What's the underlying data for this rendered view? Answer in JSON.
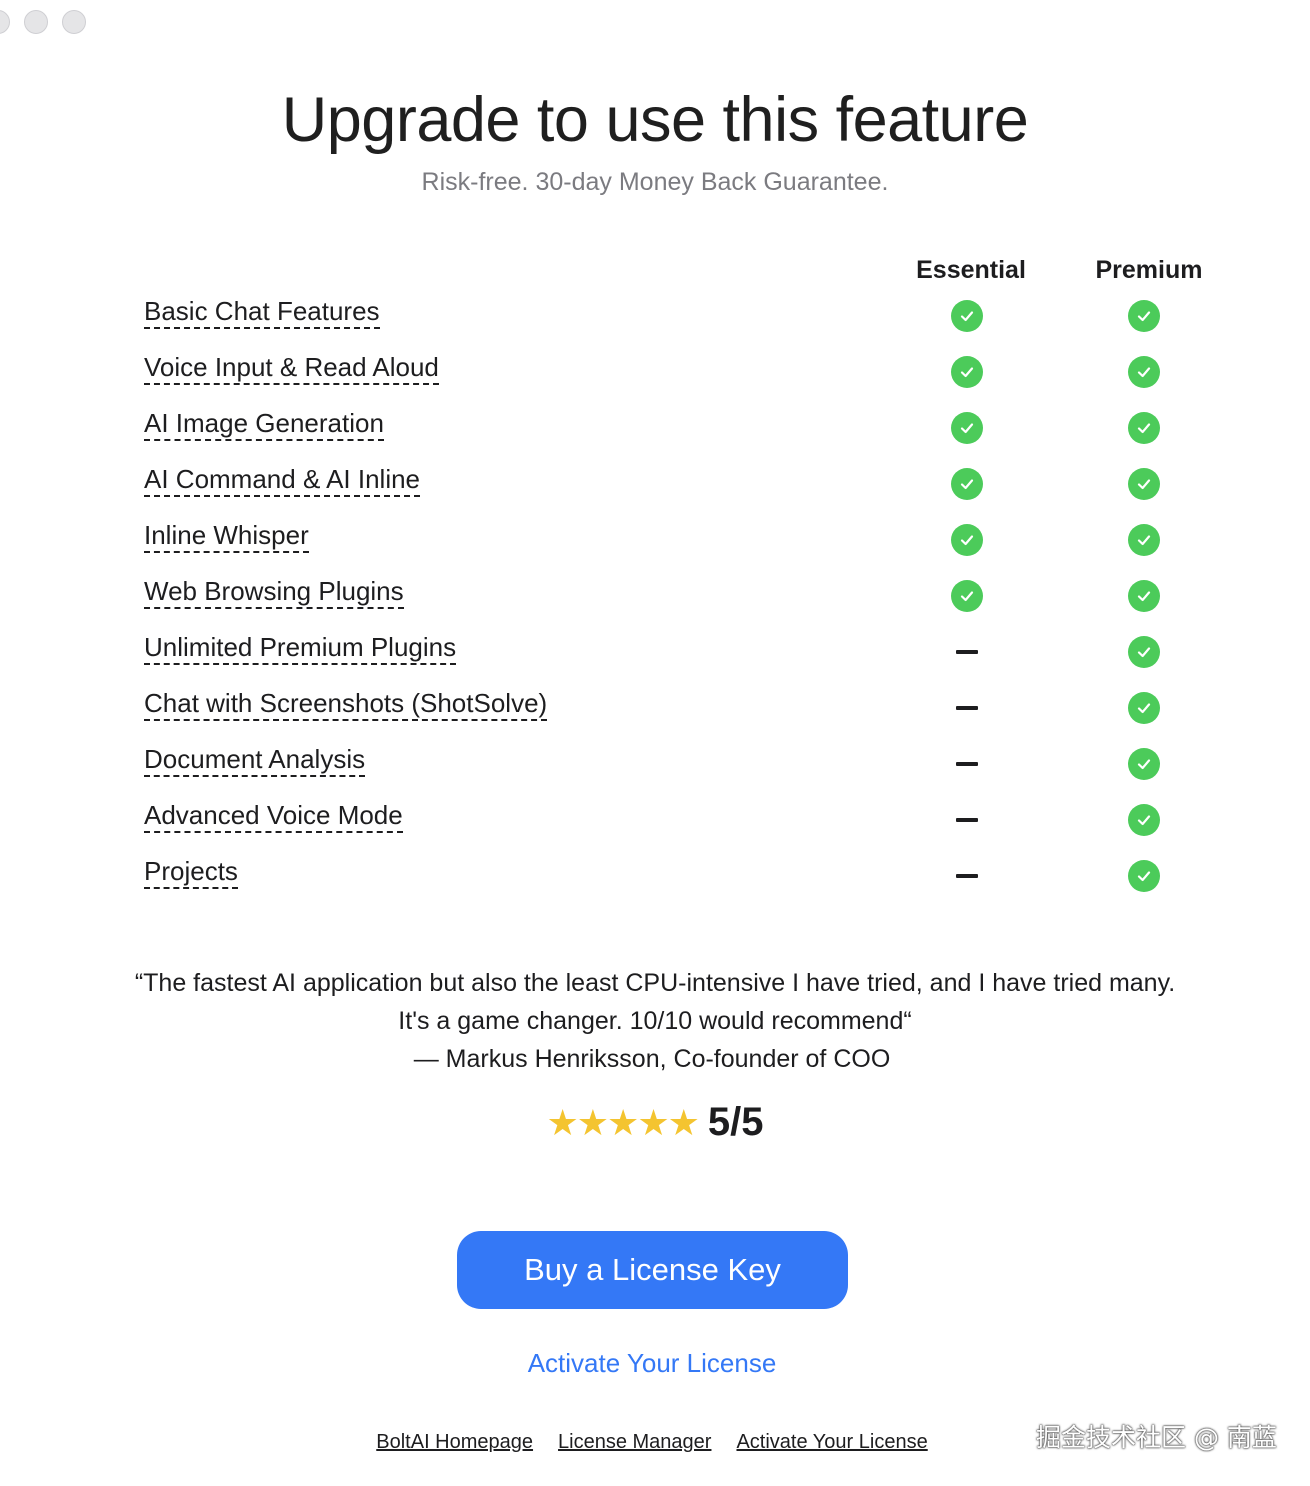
{
  "window": {
    "traffic_lights": [
      "close",
      "minimize",
      "zoom"
    ]
  },
  "header": {
    "title": "Upgrade to use this feature",
    "subtitle": "Risk-free. 30-day Money Back Guarantee."
  },
  "plans": {
    "essential": "Essential",
    "premium": "Premium"
  },
  "features": [
    {
      "label": "Basic Chat Features",
      "essential": true,
      "premium": true
    },
    {
      "label": "Voice Input & Read Aloud",
      "essential": true,
      "premium": true
    },
    {
      "label": "AI Image Generation",
      "essential": true,
      "premium": true
    },
    {
      "label": "AI Command & AI Inline",
      "essential": true,
      "premium": true
    },
    {
      "label": "Inline Whisper",
      "essential": true,
      "premium": true
    },
    {
      "label": "Web Browsing Plugins",
      "essential": true,
      "premium": true
    },
    {
      "label": "Unlimited Premium Plugins",
      "essential": false,
      "premium": true
    },
    {
      "label": "Chat with Screenshots (ShotSolve)",
      "essential": false,
      "premium": true
    },
    {
      "label": "Document Analysis",
      "essential": false,
      "premium": true
    },
    {
      "label": "Advanced Voice Mode",
      "essential": false,
      "premium": true
    },
    {
      "label": "Projects",
      "essential": false,
      "premium": true
    }
  ],
  "testimonial": {
    "quote": "“The fastest AI application but also the least CPU-intensive I have tried, and I have tried many. It's a game changer. 10/10 would recommend“",
    "author": "— Markus Henriksson, Co-founder of COO",
    "stars": "★★★★★",
    "score": "5/5"
  },
  "actions": {
    "buy_label": "Buy a License Key",
    "activate_label": "Activate Your License"
  },
  "footer": {
    "links": [
      "BoltAI Homepage",
      "License Manager",
      "Activate Your License"
    ]
  },
  "watermark": "掘金技术社区 @ 南蓝",
  "colors": {
    "accent": "#3478f6",
    "check": "#4ccb5a",
    "star": "#f4c430"
  }
}
